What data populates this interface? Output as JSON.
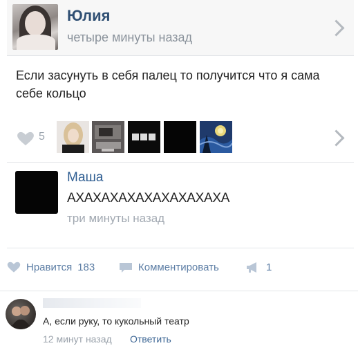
{
  "post": {
    "author_name": "Юлия",
    "time": "четыре минуты назад",
    "text": "Если засунуть в себя палец то получится что я сама себе кольцо",
    "likes": "5"
  },
  "reply": {
    "author_name": "Маша",
    "text": "АХАХАХАХАХАХАХАХАХА",
    "time": "три минуты назад"
  },
  "actions": {
    "like_label": "Нравится",
    "like_count": "183",
    "comment_label": "Комментировать",
    "share_count": "1"
  },
  "comment": {
    "text": "А, если руку, то кукольный театр",
    "time": "12 минут назад",
    "reply_label": "Ответить"
  },
  "colors": {
    "link": "#2f4f73",
    "action": "#5d7ea5",
    "muted": "#9aa3ad"
  },
  "icons": [
    "heart-icon",
    "chevron-right-icon",
    "comment-icon",
    "share-megaphone-icon"
  ]
}
